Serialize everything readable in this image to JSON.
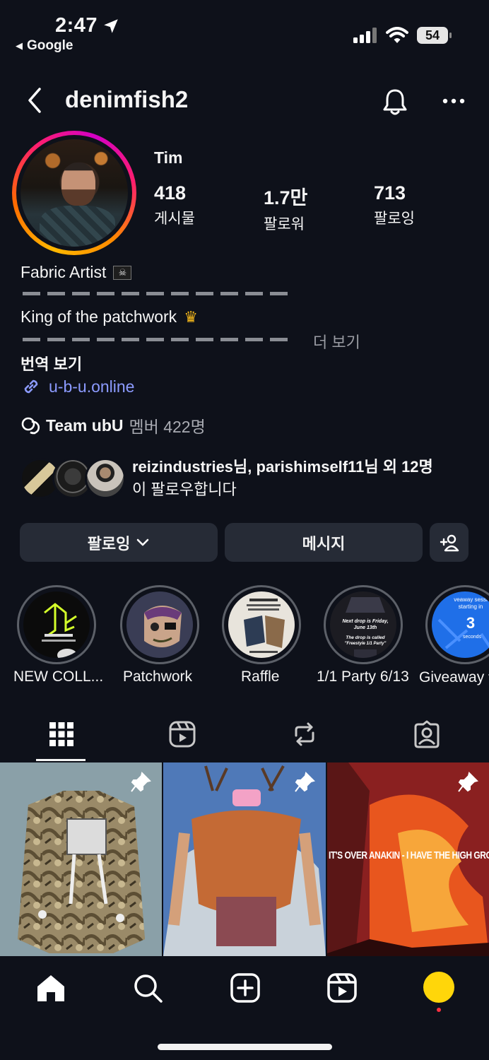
{
  "status_bar": {
    "time": "2:47",
    "back_app": "Google",
    "battery": "54"
  },
  "header": {
    "username": "denimfish2"
  },
  "profile": {
    "name": "Tim",
    "stats": [
      {
        "value": "418",
        "label": "게시물"
      },
      {
        "value": "1.7만",
        "label": "팔로워"
      },
      {
        "value": "713",
        "label": "팔로잉"
      }
    ],
    "bio_line1": "Fabric Artist",
    "bio_line2": "King of the patchwork",
    "more": "더 보기",
    "translate": "번역 보기",
    "link": "u-b-u.online",
    "community_name": "Team ubU",
    "community_members": "멤버 422명"
  },
  "followed_by": {
    "names": "reizindustries님, parishimself11님 외 12명",
    "suffix": "이 팔로우합니다"
  },
  "buttons": {
    "following": "팔로잉",
    "message": "메시지"
  },
  "highlights": [
    {
      "label": "NEW COLL..."
    },
    {
      "label": "Patchwork"
    },
    {
      "label": "Raffle"
    },
    {
      "label": "1/1 Party 6/13"
    },
    {
      "label": "Giveaway ▾"
    }
  ],
  "highlight_texts": {
    "party_line1": "Next drop is Friday, June 13th",
    "party_line2": "The drop is called \"Freestyle 1/1 Party\"",
    "giveaway_top": "veaway sessi starting in",
    "giveaway_num": "3",
    "giveaway_unit": "seconds"
  },
  "posts": [
    {
      "caption": ""
    },
    {
      "caption": ""
    },
    {
      "caption": "IT'S OVER ANAKIN - I HAVE THE HIGH GROUND"
    }
  ],
  "icons": {
    "back": "chevron-left-icon",
    "bell": "bell-icon",
    "more": "more-horizontal-icon",
    "link": "link-icon",
    "community": "community-icon",
    "add_user": "add-person-icon",
    "grid": "grid-icon",
    "reels": "reels-icon",
    "reposts": "repost-icon",
    "tagged": "tagged-icon",
    "home": "home-icon",
    "search": "search-icon",
    "create": "create-icon"
  },
  "colors": {
    "background": "#0e111a",
    "button": "#262b36",
    "link": "#8c9bff",
    "avatar_nav": "#ffd60a"
  }
}
